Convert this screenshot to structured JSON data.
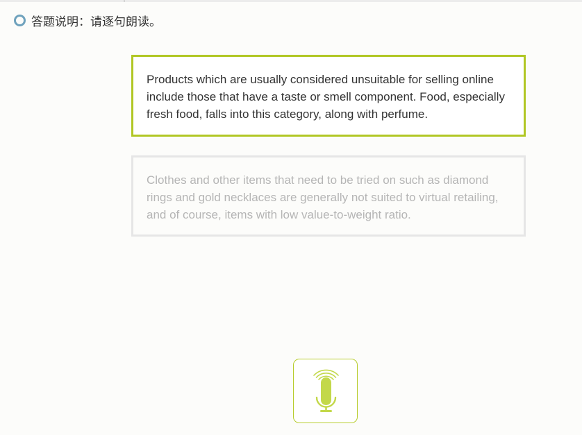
{
  "instruction": {
    "icon": "ring-icon",
    "text": "答题说明：请逐句朗读。"
  },
  "sentences": [
    {
      "text": "Products which are usually considered unsuitable for selling online include those that have a taste or smell component. Food, especially fresh food, falls into this category, along with perfume.",
      "state": "active"
    },
    {
      "text": "Clothes and other items that need to be tried on such as diamond rings and gold necklaces are generally not suited to virtual retailing, and of course, items with low value-to-weight ratio.",
      "state": "inactive"
    }
  ],
  "record_button": {
    "icon": "microphone-icon"
  },
  "colors": {
    "accent": "#b1c724",
    "mic": "#c3d84a",
    "ring": "#6fa2bd",
    "text": "#333333",
    "muted_text": "#b5b5b5",
    "inactive_border": "#e6e6e6"
  }
}
